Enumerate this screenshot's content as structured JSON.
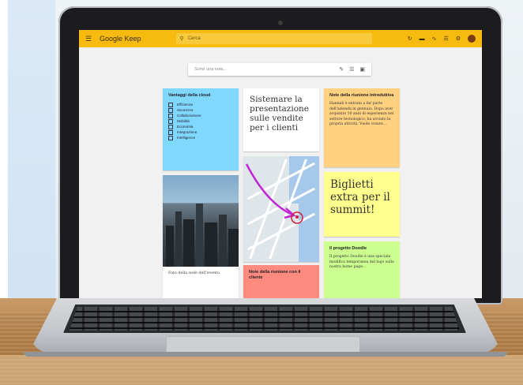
{
  "app": {
    "logo": "Google Keep",
    "search_placeholder": "Cerca",
    "take_note_placeholder": "Scrivi una nota..."
  },
  "icons": {
    "menu": "hamburger-icon",
    "search": "search-icon",
    "refresh": "refresh-icon",
    "list_view": "list-view-icon",
    "apps": "apps-icon",
    "notifications": "notifications-icon",
    "settings": "gear-icon",
    "pen": "pen-icon",
    "checklist": "checklist-icon",
    "image": "image-icon"
  },
  "colors": {
    "topbar": "#f7bb0f",
    "blue_note": "#80d8ff",
    "orange_note": "#ffd180",
    "yellow_note": "#ffff8d",
    "green_note": "#ccff90",
    "red_note": "#ff8a80",
    "annotation_pen": "#c026d3"
  },
  "notes": {
    "cloud": {
      "title": "Vantaggi della cloud",
      "items": [
        "Efficienza",
        "Sicurezza",
        "Collaborazione",
        "Mobilità",
        "Economia",
        "Integrazione",
        "Intelligence"
      ]
    },
    "presentation": {
      "text": "Sistemare la presentazione sulle vendite per i clienti"
    },
    "meeting_intro": {
      "title": "Note della riunione introduttiva",
      "body": "Hannah è entrata a far parte dell'azienda in gennaio. Dopo aver acquisito 10 anni di esperienza nel settore tecnologico, ha avviato la propria attività. Vuole creare..."
    },
    "photo": {
      "caption": "Foto della sede dell'evento"
    },
    "tickets": {
      "text": "Biglietti extra per il summit!"
    },
    "meeting_notes": {
      "title": "Note della riunione con il cliente"
    },
    "doodle": {
      "title": "Il progetto Doodle",
      "body": "Il progetto Doodle è una speciale modifica temporanea del logo sulla nostra home page..."
    }
  }
}
